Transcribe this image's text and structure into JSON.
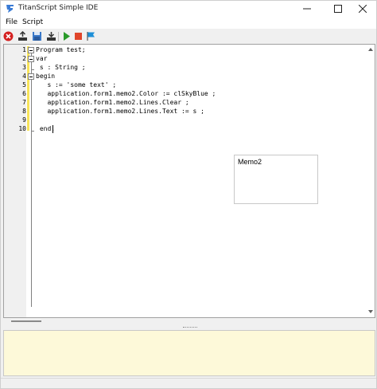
{
  "window": {
    "title": "TitanScript Simple IDE"
  },
  "menu": {
    "items": [
      {
        "label": "File"
      },
      {
        "label": "Script"
      }
    ]
  },
  "toolbar": {
    "icons": [
      "stop-icon",
      "open-icon",
      "save-icon",
      "export-icon",
      "run-icon",
      "halt-icon",
      "flag-icon"
    ],
    "colors": {
      "stop": "#d42020",
      "run": "#2a9a2a",
      "halt": "#e0452a",
      "flag": "#1e90d8"
    }
  },
  "editor": {
    "lines": [
      {
        "num": "1",
        "text": "Program test;"
      },
      {
        "num": "2",
        "text": "var"
      },
      {
        "num": "3",
        "text": " s : String ;"
      },
      {
        "num": "4",
        "text": "begin"
      },
      {
        "num": "5",
        "text": "   s := 'some text' ;"
      },
      {
        "num": "6",
        "text": "   application.form1.memo2.Color := clSkyBlue ;"
      },
      {
        "num": "7",
        "text": "   application.form1.memo2.Lines.Clear ;"
      },
      {
        "num": "8",
        "text": "   application.form1.memo2.Lines.Text := s ;"
      },
      {
        "num": "9",
        "text": ""
      },
      {
        "num": "10",
        "text": " end."
      }
    ],
    "modified_marker_color": "#f7e35a"
  },
  "memo": {
    "text": "Memo2"
  },
  "message_panel": {
    "background": "#fdf9d9"
  }
}
